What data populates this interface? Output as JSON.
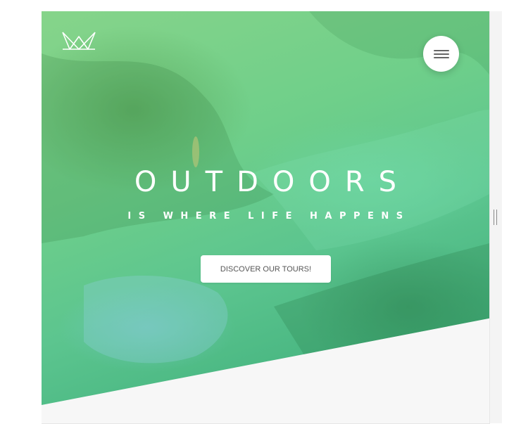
{
  "header": {
    "logo_icon": "crown-icon",
    "menu_icon": "hamburger-icon"
  },
  "hero": {
    "title": "OUTDOORS",
    "subtitle": "IS WHERE LIFE HAPPENS",
    "cta_label": "DISCOVER OUR TOURS!"
  },
  "colors": {
    "accent": "#55c38a",
    "button_bg": "#ffffff",
    "button_text": "#555555"
  }
}
